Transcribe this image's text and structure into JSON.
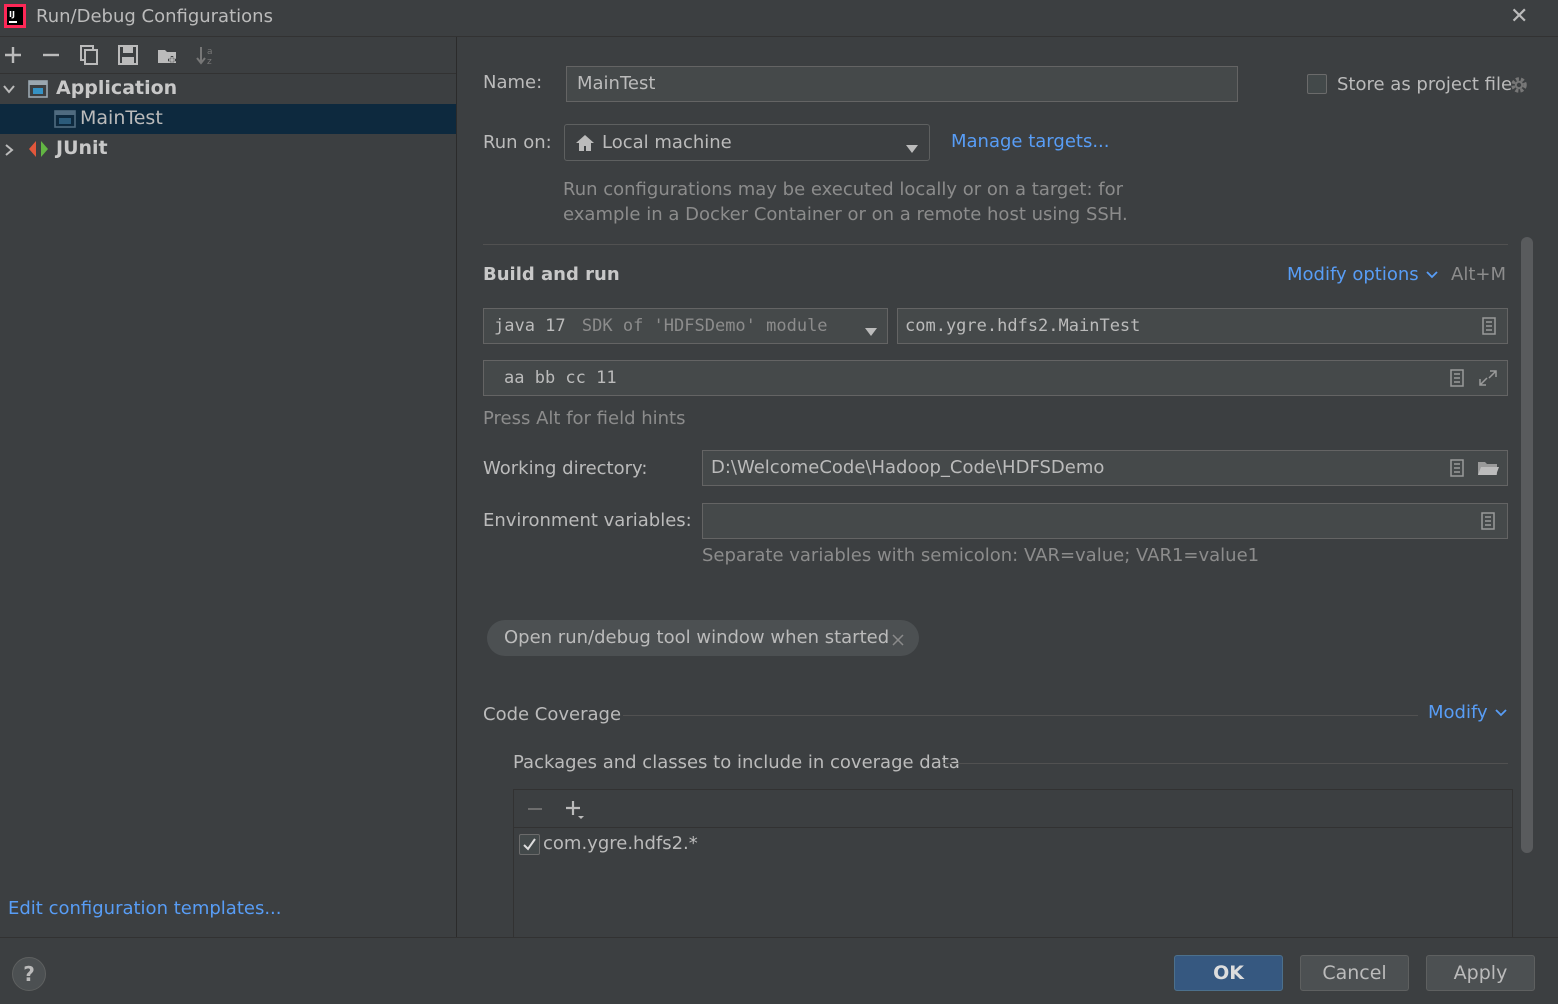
{
  "window": {
    "title": "Run/Debug Configurations",
    "app_icon": "intellij-icon"
  },
  "left": {
    "toolbar": [
      "add-icon",
      "remove-icon",
      "copy-icon",
      "save-icon",
      "new-folder-icon",
      "sort-icon"
    ],
    "tree": [
      {
        "label": "Application",
        "expanded": true,
        "bold": true,
        "icon": "application-icon",
        "children": [
          {
            "label": "MainTest",
            "selected": true,
            "icon": "application-icon"
          }
        ]
      },
      {
        "label": "JUnit",
        "expanded": false,
        "bold": true,
        "icon": "junit-icon"
      }
    ],
    "edit_templates": "Edit configuration templates..."
  },
  "form": {
    "name_label": "Name:",
    "name_value": "MainTest",
    "store_label": "Store as project file",
    "store_checked": false,
    "run_on_label": "Run on:",
    "run_on_value": "Local machine",
    "manage_targets": "Manage targets...",
    "run_on_hint_1": "Run configurations may be executed locally or on a target: for",
    "run_on_hint_2": "example in a Docker Container or on a remote host using SSH.",
    "build_run": "Build and run",
    "modify_options": "Modify options",
    "modify_shortcut": "Alt+M",
    "jdk_main": "java 17",
    "jdk_hint": "SDK of 'HDFSDemo' module",
    "main_class": "com.ygre.hdfs2.MainTest",
    "program_args": "aa bb cc 11",
    "alt_hint": "Press Alt for field hints",
    "workdir_label": "Working directory:",
    "workdir_value": "D:\\WelcomeCode\\Hadoop_Code\\HDFSDemo",
    "env_label": "Environment variables:",
    "env_value": "",
    "env_hint": "Separate variables with semicolon: VAR=value; VAR1=value1",
    "chip_label": "Open run/debug tool window when started",
    "coverage_title": "Code Coverage",
    "coverage_modify": "Modify",
    "coverage_packages_label": "Packages and classes to include in coverage data",
    "coverage_items": [
      {
        "label": "com.ygre.hdfs2.*",
        "checked": true
      }
    ]
  },
  "footer": {
    "help": "?",
    "ok": "OK",
    "cancel": "Cancel",
    "apply": "Apply"
  },
  "colors": {
    "background": "#3c3f41",
    "selection": "#0d293e",
    "link": "#589df6",
    "field": "#45494a",
    "primary": "#365880"
  }
}
